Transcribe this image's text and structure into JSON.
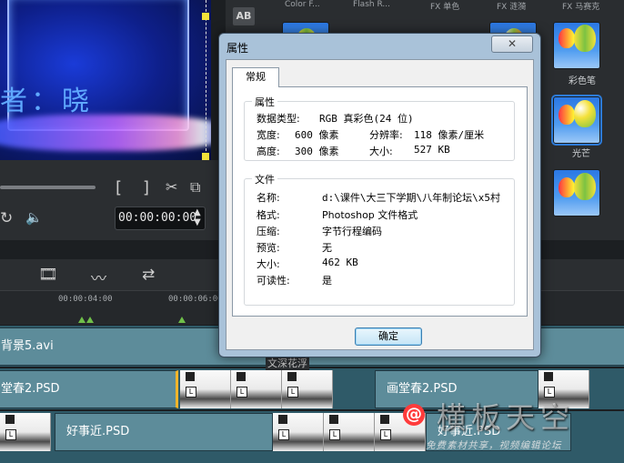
{
  "preview": {
    "title_text": "者：晓"
  },
  "controls": {
    "timecode": "00:00:00:00",
    "mark_in": "[",
    "mark_out": "]"
  },
  "library": {
    "ab_button": "AB",
    "column_labels": [
      "Color F...",
      "Flash R...",
      "FX 单色",
      "FX 涟漪",
      "FX 马赛克"
    ],
    "captions": [
      "彩色笔",
      "光芒"
    ]
  },
  "timeline": {
    "ticks": [
      "00:00:04:00",
      "00:00:06:00"
    ],
    "tracks": [
      {
        "label": "背景5.avi"
      },
      {
        "label_left": "堂春2.PSD",
        "label_right": "画堂春2.PSD"
      },
      {
        "label": "好事近.PSD",
        "label_right": "好事近.PSD"
      }
    ],
    "partial_label": "文深花浮"
  },
  "dialog": {
    "title": "属性",
    "close": "✕",
    "tab": "常规",
    "group_props": "属性",
    "data_type_label": "数据类型:",
    "data_type_value": "RGB 真彩色(24 位)",
    "width_label": "宽度:",
    "width_value": "600 像素",
    "resolution_label": "分辨率:",
    "resolution_value": "118 像素/厘米",
    "height_label": "高度:",
    "height_value": "300 像素",
    "size_label_1": "大小:",
    "size_value_1": "527 KB",
    "group_file": "文件",
    "name_label": "名称:",
    "name_value": "d:\\课件\\大三下学期\\八年制论坛\\x5村",
    "format_label": "格式:",
    "format_value": "Photoshop 文件格式",
    "compress_label": "压缩:",
    "compress_value": "字节行程编码",
    "preview_label": "预览:",
    "preview_value": "无",
    "size_label_2": "大小:",
    "size_value_2": "462 KB",
    "readable_label": "可读性:",
    "readable_value": "是",
    "ok": "确定"
  },
  "watermark": {
    "big": "横板天空",
    "small": "免费素材共享，视频编辑论坛"
  },
  "colors": {
    "accent": "#2d7bd8",
    "dialog_frame": "#a9c2d9",
    "track": "#2f5a68"
  }
}
